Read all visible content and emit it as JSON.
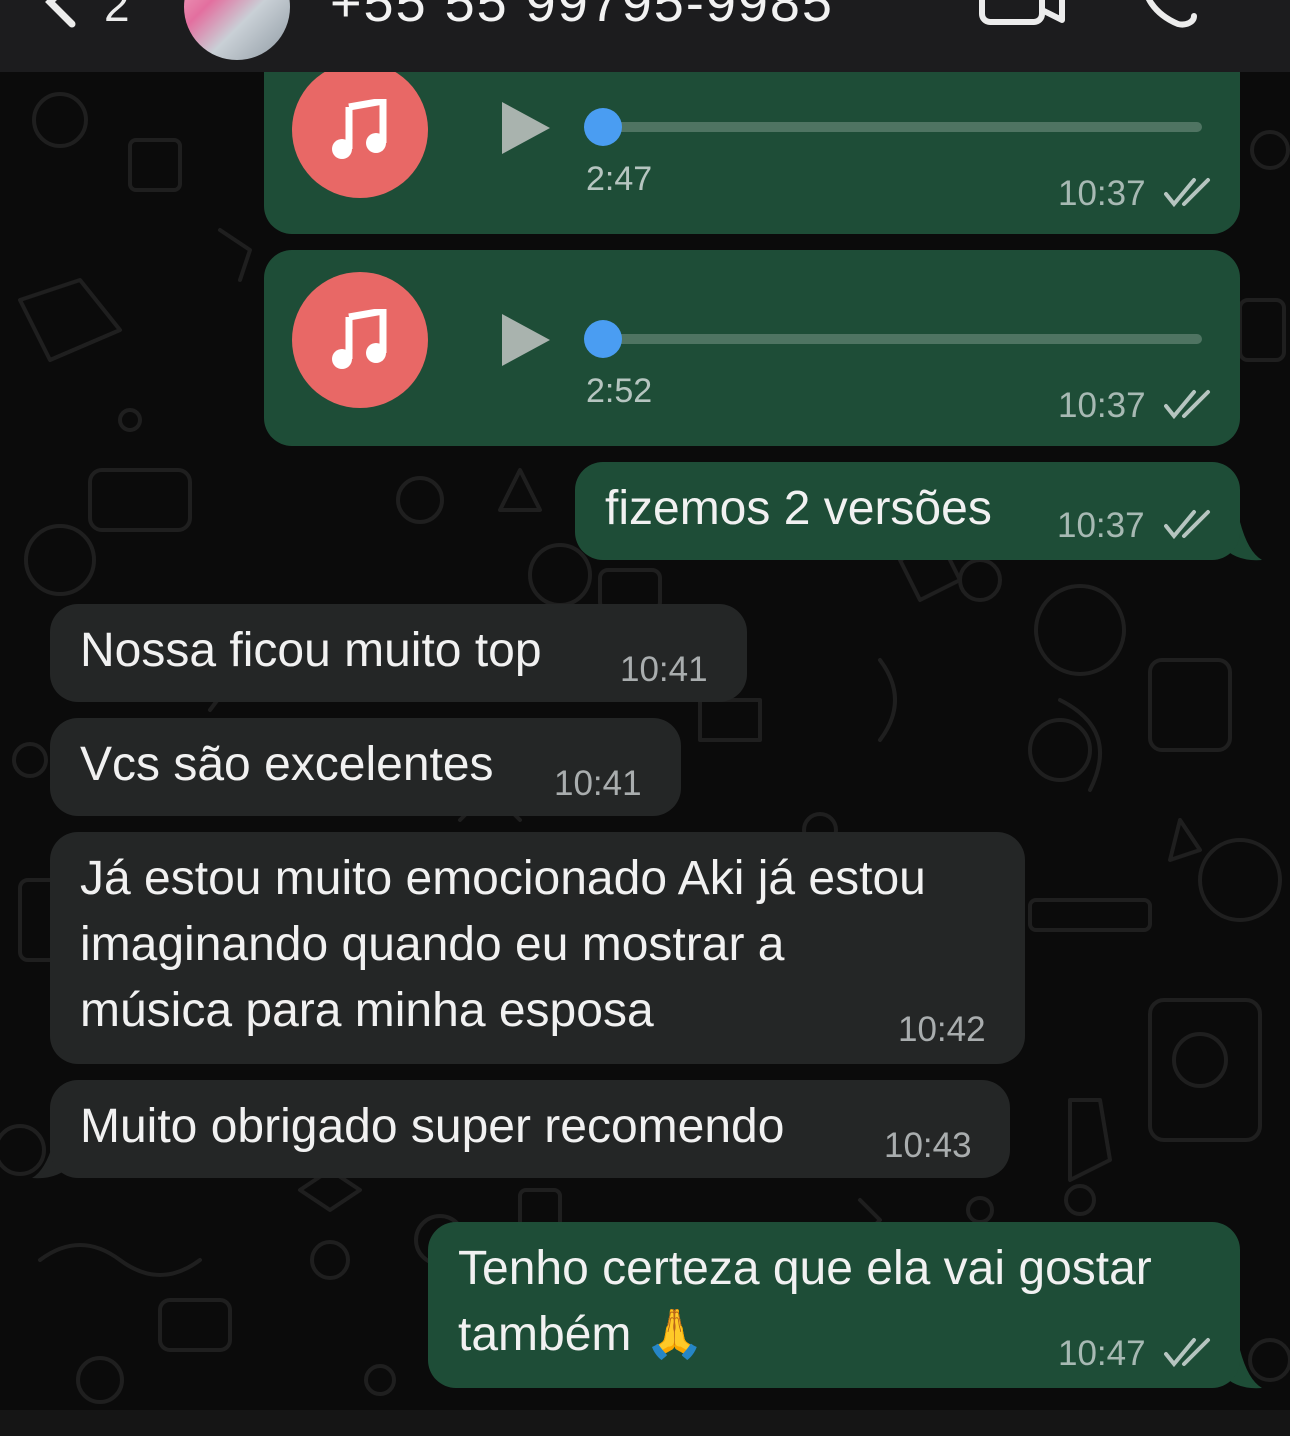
{
  "header": {
    "unread_count": "2",
    "contact_number": "+55 55 99795-9985"
  },
  "messages": [
    {
      "type": "audio",
      "direction": "outgoing",
      "duration": "2:47",
      "time": "10:37",
      "status": "read"
    },
    {
      "type": "audio",
      "direction": "outgoing",
      "duration": "2:52",
      "time": "10:37",
      "status": "read"
    },
    {
      "type": "text",
      "direction": "outgoing",
      "text": "fizemos 2 versões",
      "time": "10:37",
      "status": "read"
    },
    {
      "type": "text",
      "direction": "incoming",
      "text": "Nossa ficou muito top",
      "time": "10:41"
    },
    {
      "type": "text",
      "direction": "incoming",
      "text": "Vcs são excelentes",
      "time": "10:41"
    },
    {
      "type": "text",
      "direction": "incoming",
      "text": "Já estou muito emocionado Aki já estou\nimaginando quando eu mostrar a\nmúsica para minha esposa",
      "time": "10:42"
    },
    {
      "type": "text",
      "direction": "incoming",
      "text": "Muito obrigado super recomendo",
      "time": "10:43"
    },
    {
      "type": "text",
      "direction": "outgoing",
      "text": "Tenho certeza que ela vai gostar\ntambém 🙏",
      "time": "10:47",
      "status": "read"
    }
  ],
  "colors": {
    "outgoing_bubble": "#1e4d37",
    "incoming_bubble": "#242626",
    "audio_disc": "#e86866",
    "scrubber": "#4a9df2",
    "background": "#0b0b0b"
  },
  "icons": [
    "back-chevron-icon",
    "video-call-icon",
    "phone-call-icon",
    "music-note-icon",
    "play-icon",
    "double-check-icon",
    "praying-hands-emoji"
  ]
}
